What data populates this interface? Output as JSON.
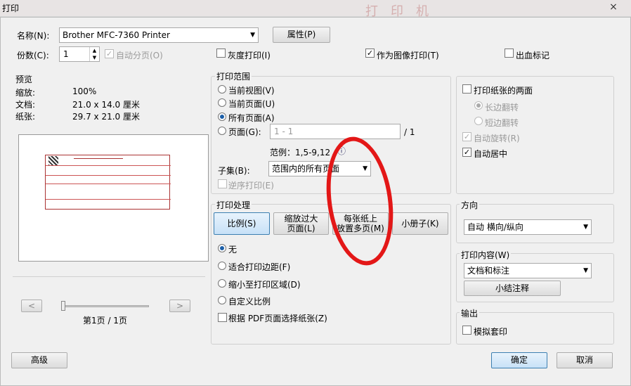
{
  "window": {
    "title": "打印",
    "close_icon": "×",
    "bg_print": "打印机"
  },
  "top": {
    "name_label": "名称(N):",
    "printer": "Brother MFC-7360 Printer",
    "properties_button": "属性(P)",
    "copies_label": "份数(C):",
    "copies_value": "1",
    "collate_label": "自动分页(O)",
    "grayscale_label": "灰度打印(I)",
    "print_as_image_label": "作为图像打印(T)",
    "bleed_marks_label": "出血标记"
  },
  "preview": {
    "title": "预览",
    "zoom_label": "缩放:",
    "zoom_value": "100%",
    "doc_label": "文档:",
    "doc_value": "21.0 x 14.0 厘米",
    "paper_label": "纸张:",
    "paper_value": "29.7 x 21.0 厘米",
    "prev_label": "<",
    "next_label": ">",
    "page_indicator": "第1页 / 1页"
  },
  "range": {
    "title": "打印范围",
    "current_view": "当前视图(V)",
    "current_page": "当前页面(U)",
    "all_pages": "所有页面(A)",
    "pages_label": "页面(G):",
    "pages_value": "1 - 1",
    "pages_total": "/ 1",
    "example": "范例：1,5-9,12",
    "info_icon": "ⓘ",
    "subset_label": "子集(B):",
    "subset_value": "范围内的所有页面",
    "reverse_label": "逆序打印(E)"
  },
  "handling": {
    "title": "打印处理",
    "tab_scale": "比例(S)",
    "tab_tile_line1": "缩放过大",
    "tab_tile_line2": "页面(L)",
    "tab_multi_line1": "每张纸上",
    "tab_multi_line2": "放置多页(M)",
    "tab_booklet": "小册子(K)",
    "opt_none": "无",
    "opt_fit": "适合打印边距(F)",
    "opt_shrink": "缩小至打印区域(D)",
    "opt_custom": "自定义比例",
    "choose_paper": "根据 PDF页面选择纸张(Z)"
  },
  "duplex": {
    "both_sides": "打印纸张的两面",
    "long_edge": "长边翻转",
    "short_edge": "短边翻转",
    "auto_rotate": "自动旋转(R)",
    "auto_center": "自动居中"
  },
  "orientation": {
    "title": "方向",
    "value": "自动 横向/纵向"
  },
  "content": {
    "title": "打印内容(W)",
    "value": "文档和标注",
    "summarize_button": "小结注释"
  },
  "output": {
    "title": "输出",
    "simulate": "模拟套印"
  },
  "footer": {
    "advanced": "高级",
    "ok": "确定",
    "cancel": "取消"
  },
  "chevron_down_icon": "▼",
  "check_icon": "✓"
}
